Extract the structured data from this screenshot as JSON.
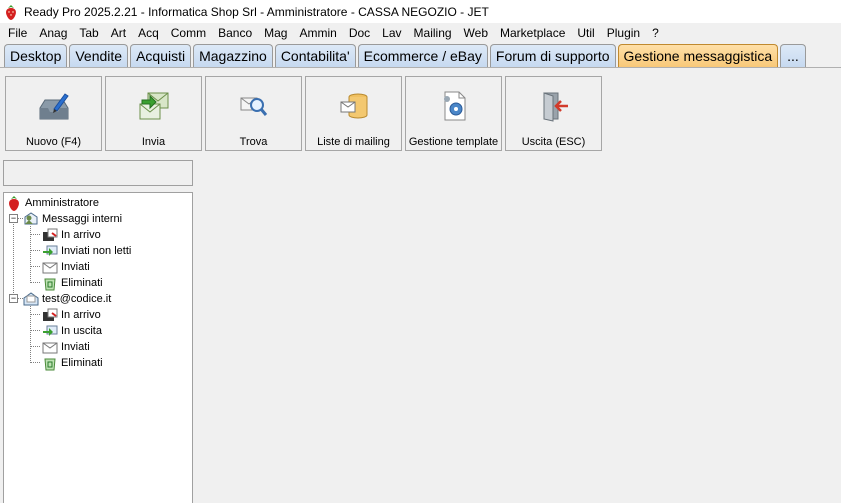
{
  "window": {
    "title": "Ready Pro 2025.2.21 - Informatica Shop Srl - Amministratore - CASSA NEGOZIO - JET"
  },
  "menu": [
    "File",
    "Anag",
    "Tab",
    "Art",
    "Acq",
    "Comm",
    "Banco",
    "Mag",
    "Ammin",
    "Doc",
    "Lav",
    "Mailing",
    "Web",
    "Marketplace",
    "Util",
    "Plugin",
    "?"
  ],
  "tabs": [
    {
      "label": "Desktop"
    },
    {
      "label": "Vendite"
    },
    {
      "label": "Acquisti"
    },
    {
      "label": "Magazzino"
    },
    {
      "label": "Contabilita'"
    },
    {
      "label": "Ecommerce / eBay"
    },
    {
      "label": "Forum di supporto"
    },
    {
      "label": "Gestione messaggistica",
      "active": true
    },
    {
      "label": "..."
    }
  ],
  "toolbar": {
    "new_label": "Nuovo (F4)",
    "send_label": "Invia",
    "find_label": "Trova",
    "mailing_lists_label": "Liste di mailing",
    "templates_label": "Gestione template",
    "exit_label": "Uscita (ESC)"
  },
  "tree": {
    "root": "Amministratore",
    "internal": {
      "label": "Messaggi interni",
      "items": [
        "In arrivo",
        "Inviati non letti",
        "Inviati",
        "Eliminati"
      ]
    },
    "account": {
      "label": "test@codice.it",
      "items": [
        "In arrivo",
        "In uscita",
        "Inviati",
        "Eliminati"
      ]
    }
  },
  "colors": {
    "active_tab": "#f8c878",
    "tab": "#c6d9f0",
    "background": "#f0f0f0"
  }
}
